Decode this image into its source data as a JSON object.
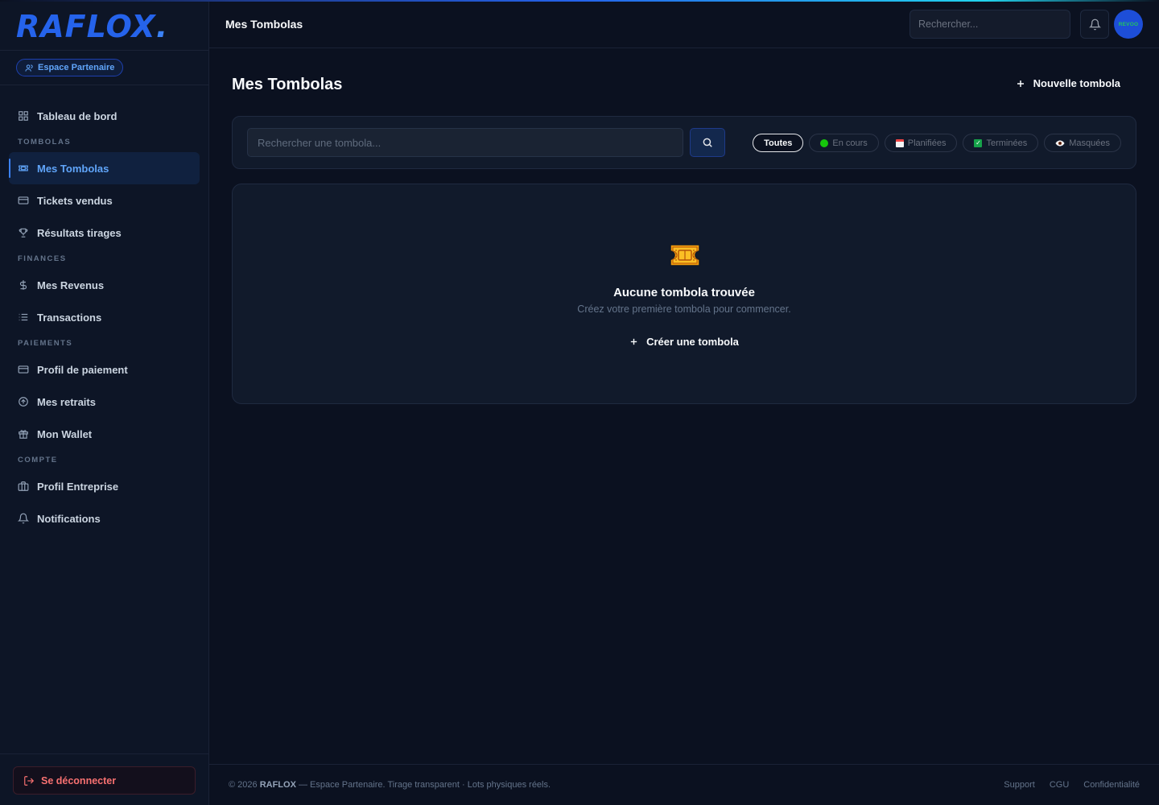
{
  "brand": {
    "logo": "RAFLOX",
    "logo_dot": ".",
    "partner_badge": "Espace Partenaire"
  },
  "sidebar": {
    "items": [
      {
        "label": "Tableau de bord",
        "icon": "grid-icon"
      },
      {
        "section": "TOMBOLAS"
      },
      {
        "label": "Mes Tombolas",
        "icon": "ticket-icon",
        "active": true
      },
      {
        "label": "Tickets vendus",
        "icon": "card-icon"
      },
      {
        "label": "Résultats tirages",
        "icon": "trophy-icon"
      },
      {
        "section": "FINANCES"
      },
      {
        "label": "Mes Revenus",
        "icon": "dollar-icon"
      },
      {
        "label": "Transactions",
        "icon": "list-icon"
      },
      {
        "section": "PAIEMENTS"
      },
      {
        "label": "Profil de paiement",
        "icon": "card-icon"
      },
      {
        "label": "Mes retraits",
        "icon": "arrow-up-circle-icon"
      },
      {
        "label": "Mon Wallet",
        "icon": "gift-icon"
      },
      {
        "section": "COMPTE"
      },
      {
        "label": "Profil Entreprise",
        "icon": "briefcase-icon"
      },
      {
        "label": "Notifications",
        "icon": "bell-icon"
      }
    ],
    "logout_label": "Se déconnecter"
  },
  "header": {
    "title": "Mes Tombolas",
    "search_placeholder": "Rechercher...",
    "avatar_text": "REVOO"
  },
  "main": {
    "page_title": "Mes Tombolas",
    "new_button": "Nouvelle tombola",
    "filter_placeholder": "Rechercher une tombola...",
    "filters": [
      {
        "label": "Toutes",
        "active": true,
        "icon": ""
      },
      {
        "label": "En cours",
        "active": false,
        "icon": "green-dot-icon"
      },
      {
        "label": "Planifiées",
        "active": false,
        "icon": "calendar-icon"
      },
      {
        "label": "Terminées",
        "active": false,
        "icon": "check-box-icon"
      },
      {
        "label": "Masquées",
        "active": false,
        "icon": "eye-icon"
      }
    ],
    "empty": {
      "title": "Aucune tombola trouvée",
      "subtitle": "Créez votre première tombola pour commencer.",
      "create_button": "Créer une tombola"
    }
  },
  "footer": {
    "copyright_prefix": "© 2026",
    "brand": "RAFLOX",
    "tagline": "— Espace Partenaire. Tirage transparent · Lots physiques réels.",
    "links": [
      "Support",
      "CGU",
      "Confidentialité"
    ]
  },
  "colors": {
    "accent": "#3b82f6",
    "background": "#0b1120",
    "danger": "#f87171"
  }
}
